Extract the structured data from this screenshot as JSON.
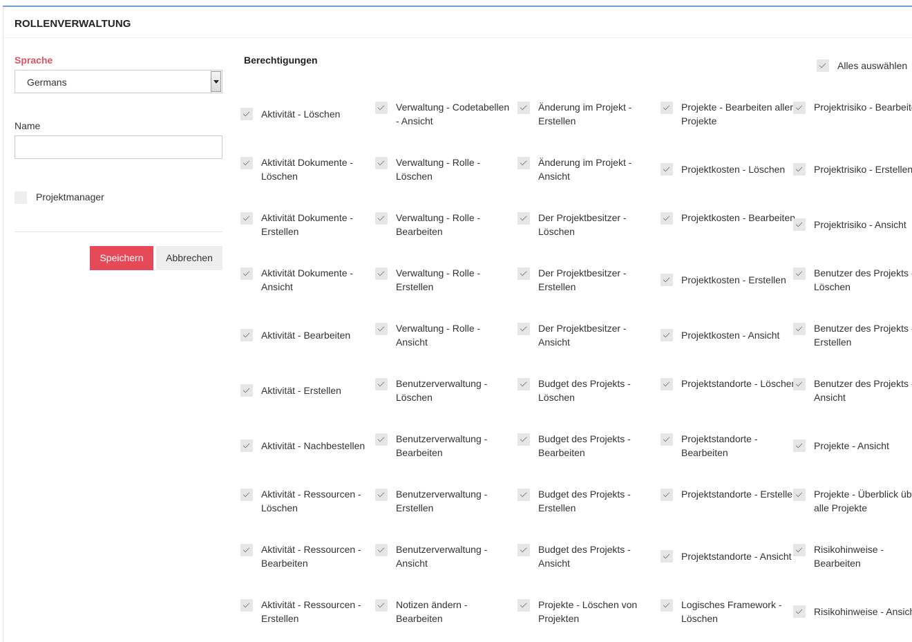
{
  "header": {
    "title": "ROLLENVERWALTUNG"
  },
  "form": {
    "language_label": "Sprache",
    "language_value": "Germans",
    "name_label": "Name",
    "name_value": "",
    "projectmanager_label": "Projektmanager",
    "projectmanager_checked": false,
    "save_label": "Speichern",
    "cancel_label": "Abbrechen"
  },
  "permissions": {
    "title": "Berechtigungen",
    "select_all_label": "Alles auswählen",
    "select_all_checked": true,
    "columns": [
      [
        "Aktivität - Löschen",
        "Aktivität Dokumente - Löschen",
        "Aktivität Dokumente - Erstellen",
        "Aktivität Dokumente - Ansicht",
        "Aktivität - Bearbeiten",
        "Aktivität - Erstellen",
        "Aktivität - Nachbestellen",
        "Aktivität - Ressourcen - Löschen",
        "Aktivität - Ressourcen - Bearbeiten",
        "Aktivität - Ressourcen - Erstellen"
      ],
      [
        "Verwaltung - Codetabellen - Ansicht",
        "Verwaltung - Rolle - Löschen",
        "Verwaltung - Rolle - Bearbeiten",
        "Verwaltung - Rolle - Erstellen",
        "Verwaltung - Rolle - Ansicht",
        "Benutzerverwaltung - Löschen",
        "Benutzerverwaltung - Bearbeiten",
        "Benutzerverwaltung - Erstellen",
        "Benutzerverwaltung - Ansicht",
        "Notizen ändern - Bearbeiten"
      ],
      [
        "Änderung im Projekt - Erstellen",
        "Änderung im Projekt - Ansicht",
        "Der Projektbesitzer - Löschen",
        "Der Projektbesitzer - Erstellen",
        "Der Projektbesitzer - Ansicht",
        "Budget des Projekts - Löschen",
        "Budget des Projekts - Bearbeiten",
        "Budget des Projekts - Erstellen",
        "Budget des Projekts - Ansicht",
        "Projekte - Löschen von Projekten"
      ],
      [
        "Projekte - Bearbeiten aller Projekte",
        "Projektkosten - Löschen",
        "Projektkosten - Bearbeiten",
        "Projektkosten - Erstellen",
        "Projektkosten - Ansicht",
        "Projektstandorte - Löschen",
        "Projektstandorte - Bearbeiten",
        "Projektstandorte - Erstellen",
        "Projektstandorte - Ansicht",
        "Logisches Framework - Löschen"
      ],
      [
        "Projektrisiko - Bearbeiten",
        "Projektrisiko - Erstellen",
        "Projektrisiko - Ansicht",
        "Benutzer des Projekts - Löschen",
        "Benutzer des Projekts - Erstellen",
        "Benutzer des Projekts - Ansicht",
        "Projekte - Ansicht",
        "Projekte - Überblick über alle Projekte",
        "Risikohinweise - Bearbeiten",
        "Risikohinweise - Ansicht"
      ]
    ]
  }
}
